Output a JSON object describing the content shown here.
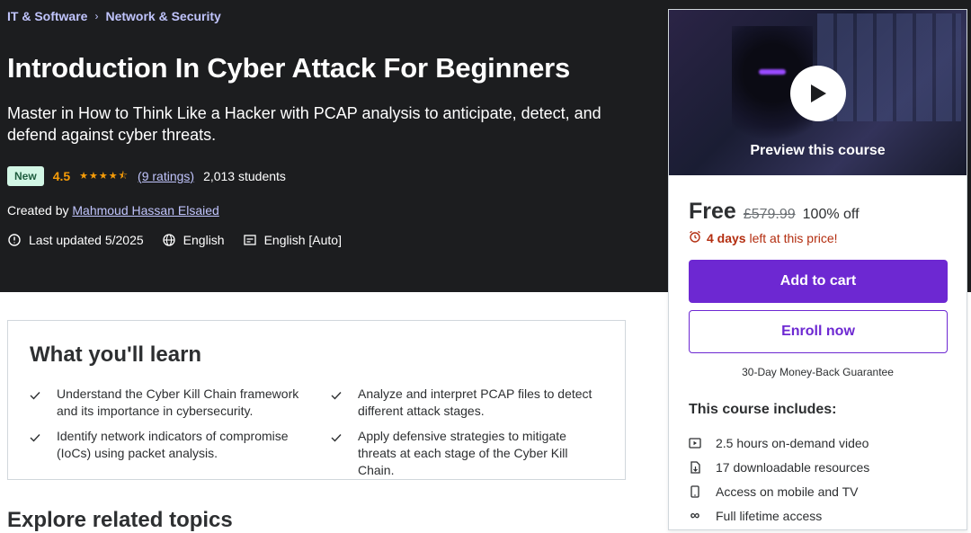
{
  "breadcrumbs": [
    "IT & Software",
    "Network & Security"
  ],
  "course": {
    "title": "Introduction In Cyber Attack For Beginners",
    "subtitle": "Master in How to Think Like a Hacker with PCAP analysis to anticipate, detect, and defend against cyber threats.",
    "badge": "New",
    "rating": "4.5",
    "ratings_text": "(9 ratings)",
    "students": "2,013 students",
    "created_by_label": "Created by",
    "author": "Mahmoud Hassan Elsaied",
    "last_updated": "Last updated 5/2025",
    "language": "English",
    "captions": "English [Auto]"
  },
  "sidebar": {
    "preview_label": "Preview this course",
    "price": "Free",
    "original_price": "£579.99",
    "discount": "100% off",
    "timer_days": "4 days",
    "timer_suffix": "left at this price!",
    "add_to_cart": "Add to cart",
    "enroll": "Enroll now",
    "guarantee": "30-Day Money-Back Guarantee",
    "includes_title": "This course includes:",
    "includes": [
      {
        "icon": "video-icon",
        "label": "2.5 hours on-demand video"
      },
      {
        "icon": "download-file-icon",
        "label": "17 downloadable resources"
      },
      {
        "icon": "mobile-icon",
        "label": "Access on mobile and TV"
      },
      {
        "icon": "infinity-icon",
        "label": "Full lifetime access"
      }
    ]
  },
  "learn": {
    "title": "What you'll learn",
    "items": [
      "Understand the Cyber Kill Chain framework and its importance in cybersecurity.",
      "Analyze and interpret PCAP files to detect different attack stages.",
      "Identify network indicators of compromise (IoCs) using packet analysis.",
      "Apply defensive strategies to mitigate threats at each stage of the Cyber Kill Chain."
    ]
  },
  "explore_title": "Explore related topics",
  "colors": {
    "accent": "#6d28d2",
    "star": "#f69c08",
    "hero_bg": "#1c1d1f",
    "link": "#c0c4fc",
    "urgent": "#b32d0f"
  }
}
